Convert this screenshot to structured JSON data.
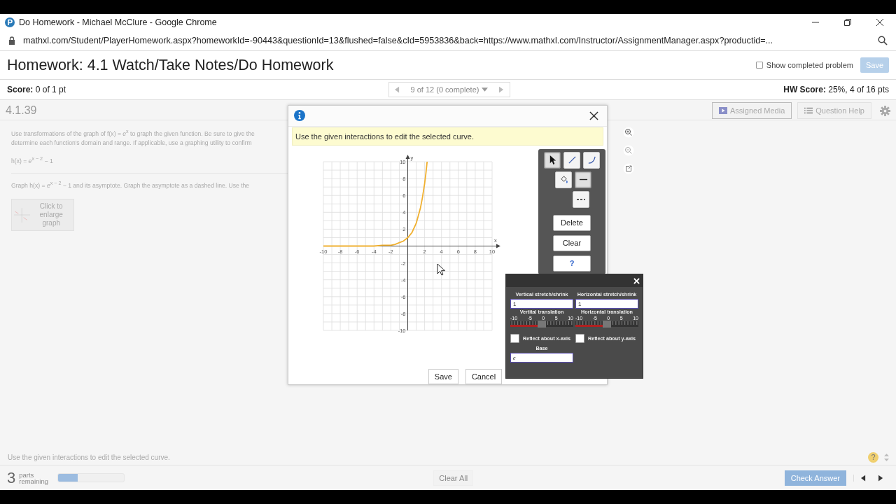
{
  "browser": {
    "title": "Do Homework - Michael McClure - Google Chrome",
    "url": "mathxl.com/Student/PlayerHomework.aspx?homeworkId=-90443&questionId=13&flushed=false&cId=5953836&back=https://www.mathxl.com/Instructor/AssignmentManager.aspx?productid=..."
  },
  "header": {
    "title": "Homework: 4.1 Watch/Take Notes/Do Homework",
    "show_completed": {
      "label": "Show completed problem",
      "checked": false
    },
    "save_button": "Save"
  },
  "score_bar": {
    "score_label": "Score:",
    "score_value": "0 of 1 pt",
    "nav_label": "9 of 12 (0 complete)",
    "hw_score_label": "HW Score:",
    "hw_score_value": "25%, 4 of 16 pts"
  },
  "question": {
    "number": "4.1.39",
    "toolbar": [
      "Assigned Media",
      "Question Help"
    ],
    "instructions": [
      "Use transformations of the graph of f(x) = *e*$^{x}$ to graph the given function. Be sure to give the",
      "determine each function's domain and range. If applicable, use a graphing utility to confirm"
    ],
    "function": "h(x) = *e*$^{x − 2}$ − 1",
    "prompt": "Graph h(x) = *e*$^{x − 2}$ − 1 and its asymptote. Graph the asymptote as a dashed line. Use the",
    "thumbnail_label": "Click to enlarge graph"
  },
  "dialog": {
    "message": "Use the given interactions to edit the selected curve.",
    "tools": [
      {
        "kind": "pointer",
        "selected": true
      },
      {
        "kind": "line",
        "selected": false
      },
      {
        "kind": "curve",
        "selected": false
      },
      {
        "kind": "fill",
        "selected": false
      },
      {
        "kind": "solid",
        "selected": true
      },
      {
        "kind": "dashed",
        "selected": false
      }
    ],
    "actions": [
      "Delete",
      "Clear",
      "?"
    ],
    "chart_data": {
      "type": "line",
      "grid": true,
      "xlabel": "x",
      "ylabel": "y",
      "xlim": [
        -10,
        10
      ],
      "ylim": [
        -10,
        10
      ],
      "xticks": [
        -10,
        -8,
        -6,
        -4,
        -2,
        2,
        4,
        6,
        8,
        10
      ],
      "yticks": [
        -10,
        -8,
        -6,
        -4,
        -2,
        2,
        4,
        6,
        8,
        10
      ],
      "x": [
        -10,
        -4,
        -3,
        -2,
        -1.5,
        -1,
        -0.5,
        0,
        0.5,
        1,
        1.5,
        1.75,
        2,
        2.15,
        2.3
      ],
      "series": [
        {
          "color": "#f0b030",
          "values": [
            0,
            0,
            0.1,
            0.1,
            0.2,
            0.4,
            0.6,
            1,
            1.6,
            2.7,
            4.5,
            5.8,
            7.4,
            8.6,
            10
          ]
        }
      ]
    },
    "buttons": [
      "Save",
      "Cancel"
    ]
  },
  "panel": {
    "vertical_stretch": {
      "label": "Vertical stretch/shrink",
      "value": "1"
    },
    "horizontal_stretch": {
      "label": "Horizontal stretch/shrink",
      "value": "1"
    },
    "translations": [
      {
        "label": "Vertital translation",
        "ticks": [
          "-10",
          "-5",
          "0",
          "5",
          "10"
        ],
        "level": 0.5
      },
      {
        "label": "Horizontal translation",
        "ticks": [
          "-10",
          "-5",
          "0",
          "5",
          "10"
        ],
        "level": 0.5
      }
    ],
    "reflections": [
      {
        "label": "Reflect about x-axis",
        "checked": false
      },
      {
        "label": "Reflect about y-axis",
        "checked": false
      }
    ],
    "base": {
      "label": "Base",
      "value": "e"
    }
  },
  "footer": {
    "message": "Use the given interactions to edit the selected curve.",
    "help_glyph": "?",
    "parts_count": "3",
    "parts_label": "parts remaining",
    "progress": {
      "level": 0.3
    },
    "clear_all": "Clear All",
    "check_answer": "Check Answer"
  }
}
